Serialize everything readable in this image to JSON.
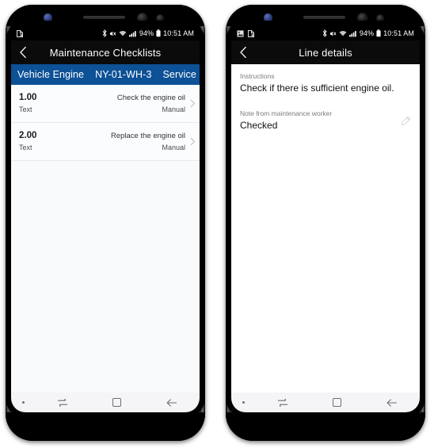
{
  "phones": [
    {
      "id": "checklist-phone",
      "status_bar": {
        "left_icons": [
          "document-icon"
        ],
        "bluetooth_icon": "bluetooth-icon",
        "mute_icon": "mute-icon",
        "wifi_icon": "wifi-icon",
        "signal_icon": "signal-icon",
        "battery_percent": "94%",
        "battery_icon": "battery-icon",
        "clock": "10:51 AM"
      },
      "app_bar": {
        "back_icon": "back-chevron-icon",
        "title": "Maintenance Checklists"
      },
      "context_bar": {
        "asset": "Vehicle Engine",
        "vehicle_id": "NY-01-WH-3",
        "type": "Service",
        "color": "#0d5196"
      },
      "list": {
        "rows": [
          {
            "line_no": "1.00",
            "line_type": "Text",
            "description": "Check the engine oil",
            "method": "Manual",
            "chevron": "chevron-right-icon"
          },
          {
            "line_no": "2.00",
            "line_type": "Text",
            "description": "Replace the engine oil",
            "method": "Manual",
            "chevron": "chevron-right-icon"
          }
        ]
      },
      "nav_bar": {
        "dot": "notification-dot-icon",
        "recents": "recents-icon",
        "home": "home-square-icon",
        "back": "back-arrow-icon"
      }
    },
    {
      "id": "details-phone",
      "status_bar": {
        "left_icons": [
          "image-icon",
          "document-icon"
        ],
        "bluetooth_icon": "bluetooth-icon",
        "mute_icon": "mute-icon",
        "wifi_icon": "wifi-icon",
        "signal_icon": "signal-icon",
        "battery_percent": "94%",
        "battery_icon": "battery-icon",
        "clock": "10:51 AM"
      },
      "app_bar": {
        "back_icon": "back-chevron-icon",
        "title": "Line details"
      },
      "details": {
        "fields": [
          {
            "label": "Instructions",
            "value": "Check if there is sufficient engine oil.",
            "editable": false
          },
          {
            "label": "Note from maintenance worker",
            "value": "Checked",
            "editable": true,
            "edit_icon": "pencil-edit-icon"
          }
        ]
      },
      "nav_bar": {
        "dot": "notification-dot-icon",
        "recents": "recents-icon",
        "home": "home-square-icon",
        "back": "back-arrow-icon"
      }
    }
  ]
}
